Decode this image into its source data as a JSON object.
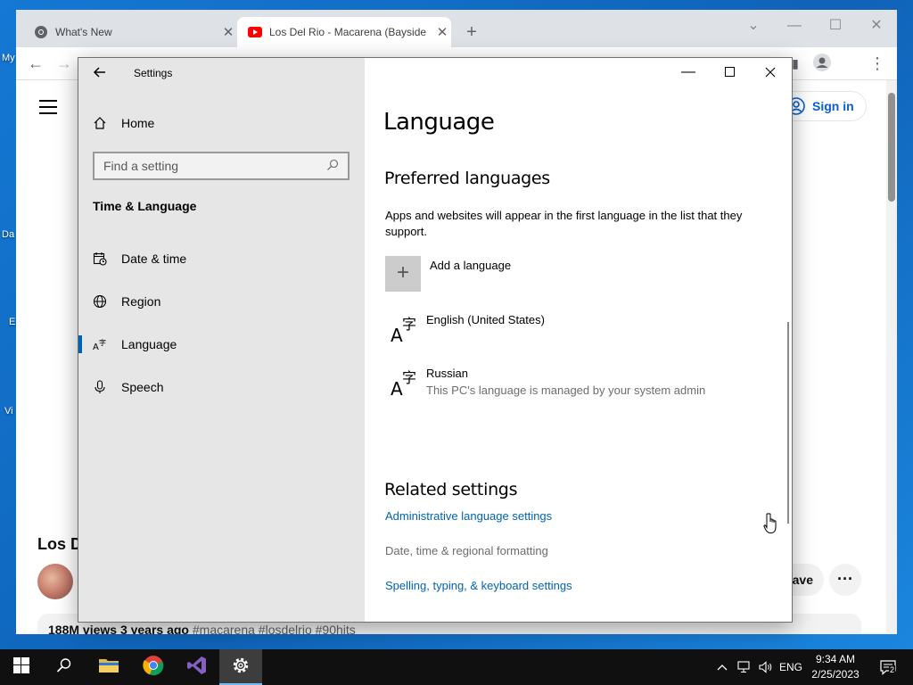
{
  "desktop": {
    "icon_labels": [
      "My",
      "Da",
      "E",
      "Vi"
    ]
  },
  "chrome": {
    "tabs": [
      {
        "title": "What's New",
        "icon": "chrome-icon"
      },
      {
        "title": "Los Del Rio - Macarena (Bayside",
        "icon": "youtube-icon"
      }
    ],
    "new_tab": "+",
    "youtube": {
      "sign_in": "Sign in",
      "video_title_partial": "Los D",
      "save_partial": "ave",
      "description_views": "188M views  3 years ago ",
      "description_tags": "#macarena #losdelrio #90hits"
    }
  },
  "settings": {
    "app_title": "Settings",
    "home": "Home",
    "search_placeholder": "Find a setting",
    "group_title": "Time & Language",
    "nav": [
      {
        "label": "Date & time",
        "icon": "calendar-clock-icon"
      },
      {
        "label": "Region",
        "icon": "globe-icon"
      },
      {
        "label": "Language",
        "icon": "language-icon",
        "active": true
      },
      {
        "label": "Speech",
        "icon": "microphone-icon"
      }
    ],
    "page_title": "Language",
    "preferred_heading": "Preferred languages",
    "preferred_desc": "Apps and websites will appear in the first language in the list that they support.",
    "add_language": "Add a language",
    "languages": [
      {
        "name": "English (United States)",
        "note": ""
      },
      {
        "name": "Russian",
        "note": "This PC's language is managed by your system admin"
      }
    ],
    "related_heading": "Related settings",
    "related_links": [
      {
        "label": "Administrative language settings",
        "enabled": true
      },
      {
        "label": "Date, time & regional formatting",
        "enabled": false
      },
      {
        "label": "Spelling, typing, & keyboard settings",
        "enabled": true
      }
    ]
  },
  "taskbar": {
    "lang": "ENG",
    "time": "9:34 AM",
    "date": "2/25/2023",
    "notification_count": "2"
  }
}
